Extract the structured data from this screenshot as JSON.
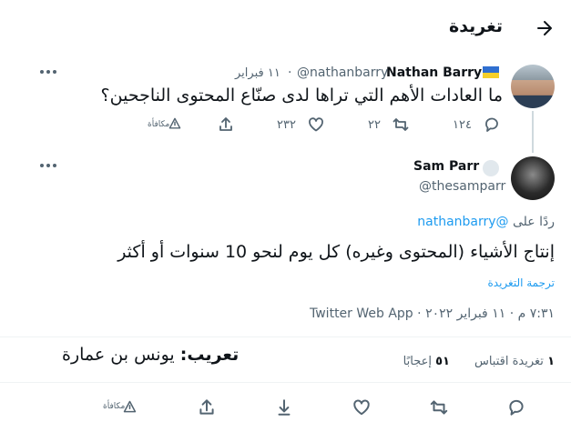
{
  "header": {
    "title": "تغريدة"
  },
  "parent_tweet": {
    "name": "Nathan Barry",
    "handle": "@nathanbarry",
    "date": "١١ فبراير",
    "sep": "·",
    "text": "ما العادات الأهم التي تراها لدى صنّاع المحتوى الناجحين؟",
    "replies": "١٢٤",
    "retweets": "٢٢",
    "likes": "٢٣٢",
    "reward_label": "مكافأة",
    "flag_colors": [
      "#2f6fd0",
      "#f5cf2a"
    ]
  },
  "main_tweet": {
    "name": "Sam Parr",
    "handle": "@thesamparr",
    "reply_prefix": "ردًا على",
    "reply_to": "@nathanbarry",
    "text": "إنتاج الأشياء (المحتوى وغيره) كل يوم لنحو 10 سنوات أو أكثر",
    "translate_link": "ترجمة التغريدة",
    "timestamp": "٧:٣١ م · ١١ فبراير ٢٠٢٢ · Twitter Web App",
    "reward_label": "مكافأة"
  },
  "stats": {
    "quote_count": "١",
    "quote_label": "تغريدة اقتباس",
    "like_count": "٥١",
    "like_label": "إعجابًا"
  },
  "watermark": {
    "label": "تعريب:",
    "name": "يونس بن عمارة"
  },
  "colors": {
    "accent": "#1d9bf0",
    "muted": "#536471",
    "border": "#eff3f4"
  }
}
